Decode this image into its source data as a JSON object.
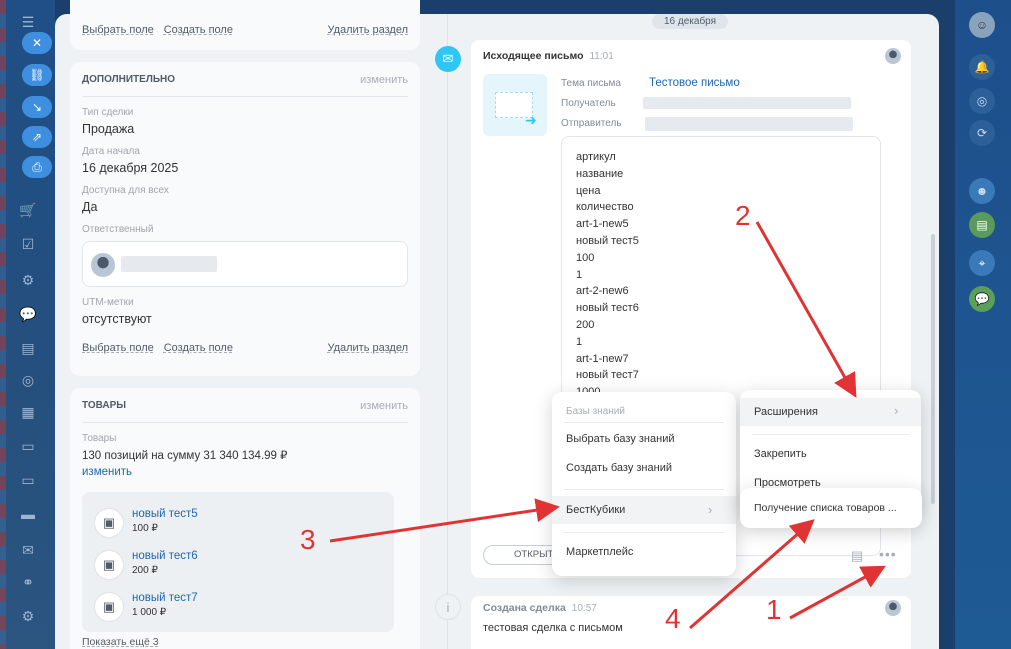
{
  "left_card_top": {
    "links": [
      "Выбрать поле",
      "Создать поле",
      "Удалить раздел"
    ]
  },
  "additional": {
    "title": "ДОПОЛНИТЕЛЬНО",
    "edit": "изменить",
    "deal_type_label": "Тип сделки",
    "deal_type_value": "Продажа",
    "start_label": "Дата начала",
    "start_value": "16 декабря 2025",
    "avail_label": "Доступна для всех",
    "avail_value": "Да",
    "resp_label": "Ответственный",
    "utm_label": "UTM-метки",
    "utm_value": "отсутствуют",
    "links": [
      "Выбрать поле",
      "Создать поле",
      "Удалить раздел"
    ]
  },
  "goods": {
    "title": "ТОВАРЫ",
    "edit": "изменить",
    "label": "Товары",
    "summary": "130 позиций на сумму 31 340 134.99 ₽",
    "change": "изменить",
    "items": [
      {
        "name": "новый тест5",
        "price": "100 ₽"
      },
      {
        "name": "новый тест6",
        "price": "200 ₽"
      },
      {
        "name": "новый тест7",
        "price": "1 000 ₽"
      }
    ],
    "show_more": "Показать ещё 3"
  },
  "timeline": {
    "date": "16 декабря",
    "email": {
      "title": "Исходящее письмо",
      "time": "11:01",
      "subject_label": "Тема письма",
      "subject_value": "Тестовое письмо",
      "recipient_label": "Получатель",
      "sender_label": "Отправитель",
      "body_lines": [
        "артикул",
        "название",
        "цена",
        "количество",
        "art-1-new5",
        "новый тест5",
        "100",
        "1",
        "art-2-new6",
        "новый тест6",
        "200",
        "1",
        "art-1-new7",
        "новый тест7",
        "1000"
      ],
      "open_button": "ОТКРЫТЬ"
    },
    "deal": {
      "title": "Создана сделка",
      "time": "10:57",
      "text": "тестовая сделка с письмом"
    }
  },
  "menu_left": {
    "header": "Базы знаний",
    "items": [
      "Выбрать базу знаний",
      "Создать базу знаний",
      "БестКубики",
      "Маркетплейс"
    ]
  },
  "menu_right": {
    "items": [
      "Расширения",
      "Закрепить",
      "Просмотреть"
    ]
  },
  "submenu": {
    "item": "Получение списка товаров ..."
  },
  "annotations": [
    "1",
    "2",
    "3",
    "4"
  ],
  "colors": {
    "accent": "#2067b0",
    "arrow": "#e03434",
    "email_icon": "#2fc6f6"
  }
}
